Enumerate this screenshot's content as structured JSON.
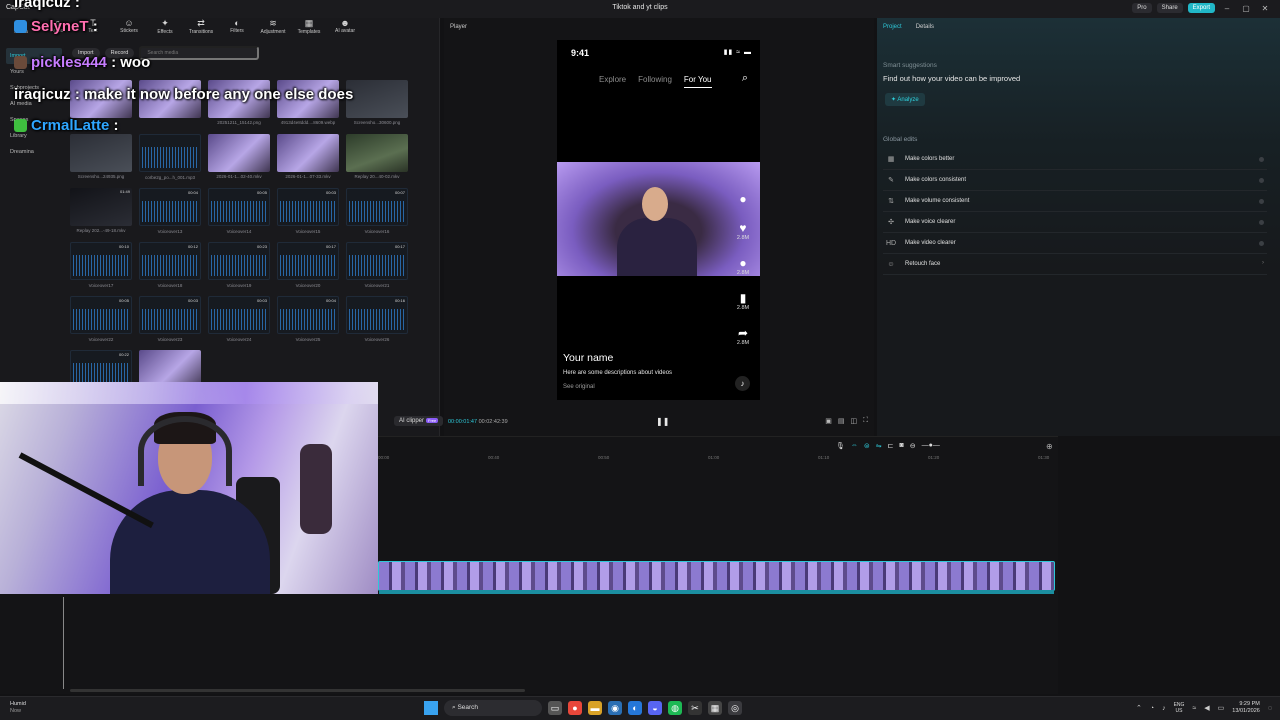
{
  "window": {
    "app_name": "CapCut",
    "title": "Tiktok and yt clips",
    "pro": "Pro",
    "share": "Share",
    "export": "Export"
  },
  "toolbar": [
    {
      "icon": "media-icon",
      "label": "Media"
    },
    {
      "icon": "audio-icon",
      "label": "Audio"
    },
    {
      "icon": "text-icon",
      "label": "Text"
    },
    {
      "icon": "stickers-icon",
      "label": "Stickers"
    },
    {
      "icon": "effects-icon",
      "label": "Effects"
    },
    {
      "icon": "transitions-icon",
      "label": "Transitions"
    },
    {
      "icon": "filters-icon",
      "label": "Filters"
    },
    {
      "icon": "adjustment-icon",
      "label": "Adjustment"
    },
    {
      "icon": "templates-icon",
      "label": "Templates"
    },
    {
      "icon": "ai-avatar-icon",
      "label": "AI avatar"
    }
  ],
  "sidebar": {
    "items": [
      {
        "label": "Import",
        "active": true
      },
      {
        "label": "Yours"
      },
      {
        "label": "Subprojects"
      },
      {
        "label": "AI media"
      },
      {
        "label": "Spaces"
      },
      {
        "label": "Library"
      },
      {
        "label": "Dreamina"
      }
    ]
  },
  "media_bar": {
    "import": "Import",
    "record": "Record",
    "search_placeholder": "Search media"
  },
  "media": [
    {
      "kind": "video",
      "name": "",
      "dur": ""
    },
    {
      "kind": "video",
      "name": "",
      "dur": ""
    },
    {
      "kind": "video",
      "name": "20251211_15142.png",
      "dur": ""
    },
    {
      "kind": "video",
      "name": "4913d4e8ddd....8609.webp",
      "dur": ""
    },
    {
      "kind": "shot",
      "name": "Screensho...30600.png",
      "dur": ""
    },
    {
      "kind": "shot",
      "name": "Screensho...24935.png",
      "dur": ""
    },
    {
      "kind": "wave",
      "name": "corbe2g_po...h_001.mp3",
      "dur": ""
    },
    {
      "kind": "video",
      "name": "2026-01-1...02-40.mkv",
      "dur": ""
    },
    {
      "kind": "video",
      "name": "2026-01-1...07-33.mkv",
      "dur": ""
    },
    {
      "kind": "green",
      "name": "Replay 20...40-02.mkv",
      "dur": ""
    },
    {
      "kind": "dark",
      "name": "Replay 202...-49-18.mkv",
      "dur": "01:49"
    },
    {
      "kind": "wave",
      "name": "Voiceover13",
      "dur": "00:04"
    },
    {
      "kind": "wave",
      "name": "Voiceover14",
      "dur": "00:05"
    },
    {
      "kind": "wave",
      "name": "Voiceover15",
      "dur": "00:03"
    },
    {
      "kind": "wave",
      "name": "Voiceover16",
      "dur": "00:07"
    },
    {
      "kind": "wave",
      "name": "Voiceover17",
      "dur": "00:10"
    },
    {
      "kind": "wave",
      "name": "Voiceover18",
      "dur": "00:12"
    },
    {
      "kind": "wave",
      "name": "Voiceover19",
      "dur": "00:23"
    },
    {
      "kind": "wave",
      "name": "Voiceover20",
      "dur": "00:17"
    },
    {
      "kind": "wave",
      "name": "Voiceover21",
      "dur": "00:17"
    },
    {
      "kind": "wave",
      "name": "Voiceover22",
      "dur": "00:05"
    },
    {
      "kind": "wave",
      "name": "Voiceover23",
      "dur": "00:03"
    },
    {
      "kind": "wave",
      "name": "Voiceover24",
      "dur": "00:03"
    },
    {
      "kind": "wave",
      "name": "Voiceover25",
      "dur": "00:04"
    },
    {
      "kind": "wave",
      "name": "Voiceover26",
      "dur": "00:16"
    },
    {
      "kind": "wave",
      "name": "",
      "dur": "00:22"
    },
    {
      "kind": "video",
      "name": "",
      "dur": ""
    }
  ],
  "chat": [
    {
      "user": "iraqicuz",
      "sep": " :",
      "msg": "",
      "color": "#ffffff",
      "badge": ""
    },
    {
      "user": "SelyneT",
      "sep": " :",
      "msg": "",
      "color": "#ff6fb0",
      "badge": "#2f8fe0"
    },
    {
      "user": "pickles444",
      "sep": " :",
      "msg": " woo",
      "color": "#c77dff",
      "badge": "#6a4a3a"
    },
    {
      "user": "iraqicuz",
      "sep": " :",
      "msg": " make it now before any one else does",
      "color": "#ffffff",
      "badge": ""
    },
    {
      "user": "CrmalLatte",
      "sep": " :",
      "msg": "",
      "color": "#2fa6ff",
      "badge": "#3fbf3f"
    }
  ],
  "player": {
    "title": "Player",
    "phone": {
      "time": "9:41",
      "nav": [
        "Explore",
        "Following",
        "For You"
      ],
      "counts": [
        "2.8M",
        "2.8M",
        "2.8M",
        "2.8M"
      ],
      "name": "Your name",
      "desc": "Here are some descriptions about videos",
      "see_original": "See original"
    },
    "ai_clipper": "AI clipper",
    "ai_clipper_badge": "Free",
    "current": "00:00:01:47",
    "total": "00:02:42:39"
  },
  "right": {
    "tabs": [
      "Project",
      "Details"
    ],
    "smart_title": "Smart suggestions",
    "smart_desc": "Find out how your video can be improved",
    "analyze": "Analyze",
    "global_title": "Global edits",
    "edits": [
      {
        "icon": "colors-icon",
        "label": "Make colors better"
      },
      {
        "icon": "consistent-icon",
        "label": "Make colors consistent"
      },
      {
        "icon": "volume-icon",
        "label": "Make volume consistent"
      },
      {
        "icon": "voice-icon",
        "label": "Make voice clearer"
      },
      {
        "icon": "hd-icon",
        "label": "Make video clearer"
      },
      {
        "icon": "face-icon",
        "label": "Retouch face"
      }
    ]
  },
  "timeline": {
    "ruler": [
      "00:00",
      "00:40",
      "00:50",
      "01:00",
      "01:10",
      "01:20",
      "01:30"
    ]
  },
  "taskbar": {
    "weather_title": "Humid",
    "weather_sub": "Now",
    "search": "Search",
    "lang1": "ENG",
    "lang2": "US",
    "time": "9:29 PM",
    "date": "13/01/2026"
  }
}
